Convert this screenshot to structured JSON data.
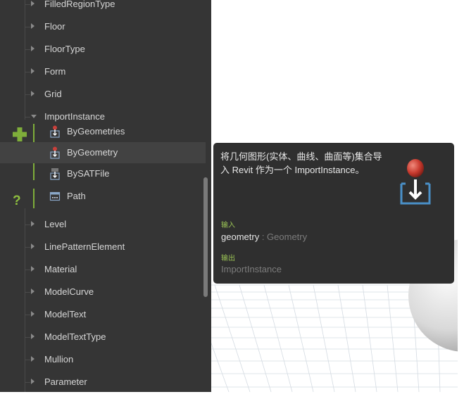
{
  "library": {
    "items_before": [
      {
        "label": "FilledRegionType"
      },
      {
        "label": "Floor"
      },
      {
        "label": "FloorType"
      },
      {
        "label": "Form"
      },
      {
        "label": "Grid"
      }
    ],
    "expanded": {
      "label": "ImportInstance",
      "children": [
        {
          "label": "ByGeometries",
          "icon": "node-create-icon",
          "selected": false
        },
        {
          "label": "ByGeometry",
          "icon": "node-create-icon",
          "selected": true
        },
        {
          "label": "BySATFile",
          "icon": "sat-file-node-icon",
          "selected": false
        },
        {
          "label": "Path",
          "icon": "query-path-icon",
          "selected": false
        }
      ]
    },
    "items_after": [
      {
        "label": "Level"
      },
      {
        "label": "LinePatternElement"
      },
      {
        "label": "Material"
      },
      {
        "label": "ModelCurve"
      },
      {
        "label": "ModelText"
      },
      {
        "label": "ModelTextType"
      },
      {
        "label": "Mullion"
      },
      {
        "label": "Parameter"
      }
    ],
    "section_icons": {
      "create": "plus-icon",
      "query": "question-icon"
    },
    "help_glyph": "?",
    "accent": "#7fae3a"
  },
  "tooltip": {
    "description": "将几何图形(实体、曲线、曲面等)集合导入 Revit 作为一个 ImportInstance。",
    "inputs_title": "输入",
    "input_name": "geometry",
    "input_separator": " : ",
    "input_type": "Geometry",
    "outputs_title": "输出",
    "output_name": "ImportInstance",
    "graphic_icon": "import-geometry-icon"
  }
}
